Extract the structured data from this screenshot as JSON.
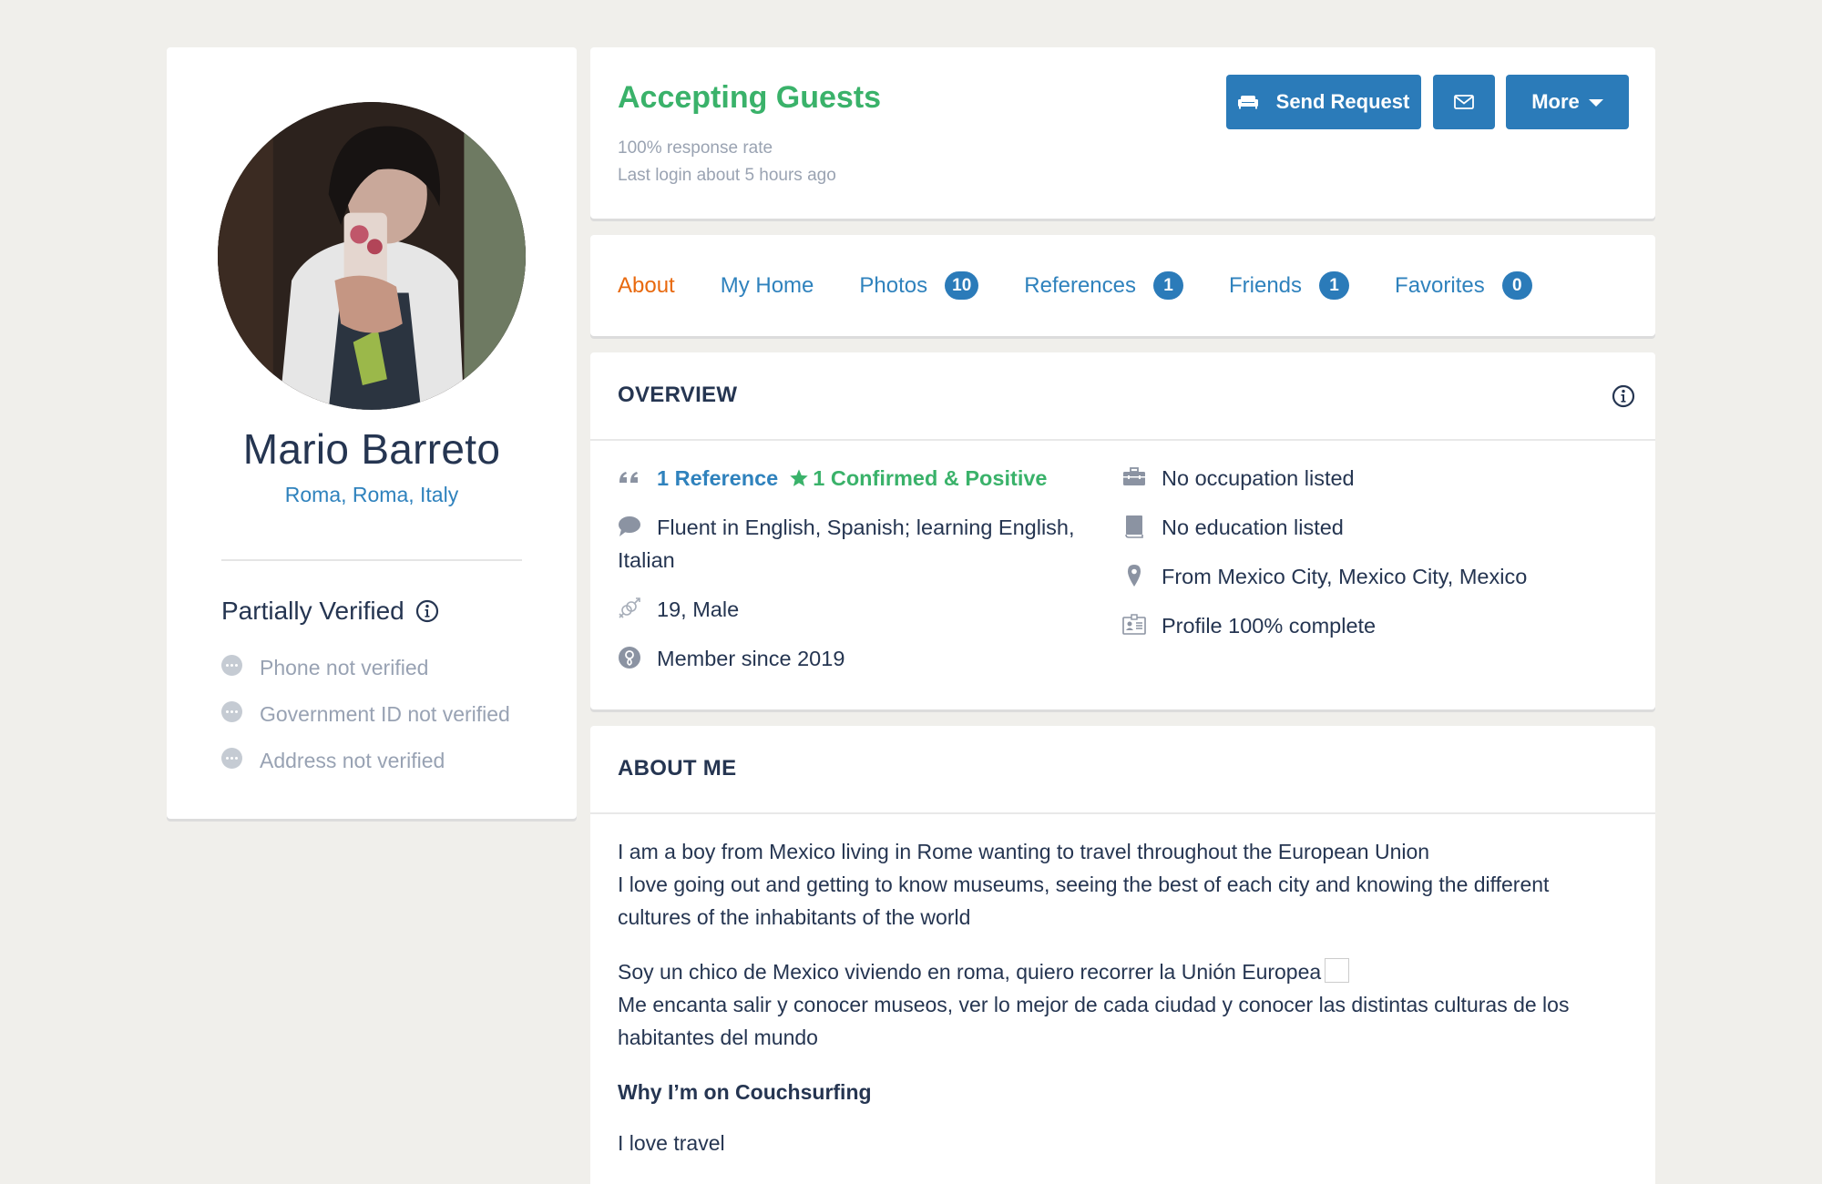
{
  "profile": {
    "name": "Mario Barreto",
    "location": "Roma, Roma, Italy",
    "avatar_icon": "user-avatar-photo",
    "verification": {
      "title": "Partially Verified",
      "items": [
        {
          "label": "Phone not verified",
          "icon": "unverified-dots-icon"
        },
        {
          "label": "Government ID not verified",
          "icon": "unverified-dots-icon"
        },
        {
          "label": "Address not verified",
          "icon": "unverified-dots-icon"
        }
      ]
    }
  },
  "header": {
    "status": "Accepting Guests",
    "response_rate": "100% response rate",
    "last_login": "Last login about 5 hours ago",
    "buttons": {
      "send_request": "Send Request",
      "more": "More"
    }
  },
  "tabs": [
    {
      "label": "About",
      "active": true
    },
    {
      "label": "My Home"
    },
    {
      "label": "Photos",
      "count": "10"
    },
    {
      "label": "References",
      "count": "1"
    },
    {
      "label": "Friends",
      "count": "1"
    },
    {
      "label": "Favorites",
      "count": "0"
    }
  ],
  "overview": {
    "title": "OVERVIEW",
    "left": {
      "references": "1 Reference",
      "confirmed": "1 Confirmed & Positive",
      "languages": "Fluent in English, Spanish; learning English, Italian",
      "age_gender": "19, Male",
      "member_since": "Member since 2019"
    },
    "right": {
      "occupation": "No occupation listed",
      "education": "No education listed",
      "hometown": "From Mexico City, Mexico City, Mexico",
      "completion": "Profile 100% complete"
    }
  },
  "about_me": {
    "title": "ABOUT ME",
    "para1_line1": "I am a boy from Mexico living in Rome wanting to travel throughout the European Union",
    "para1_line2": "I love going out and getting to know museums, seeing the best of each city and knowing the different cultures of the inhabitants of the world",
    "para2_line1": "Soy un chico de Mexico viviendo en roma, quiero recorrer la Unión Europea",
    "para2_line2": "Me encanta salir y conocer museos, ver lo mejor de cada ciudad y conocer las distintas culturas de los habitantes del mundo",
    "why_heading": "Why I’m on Couchsurfing",
    "why_text": "I love travel"
  },
  "colors": {
    "accent_blue": "#2b7bb9",
    "link_blue": "#2f82bd",
    "status_green": "#3ab26a",
    "active_tab_orange": "#e8690e",
    "text_dark": "#253551",
    "muted": "#9aa3b2",
    "background": "#f0efeb"
  }
}
